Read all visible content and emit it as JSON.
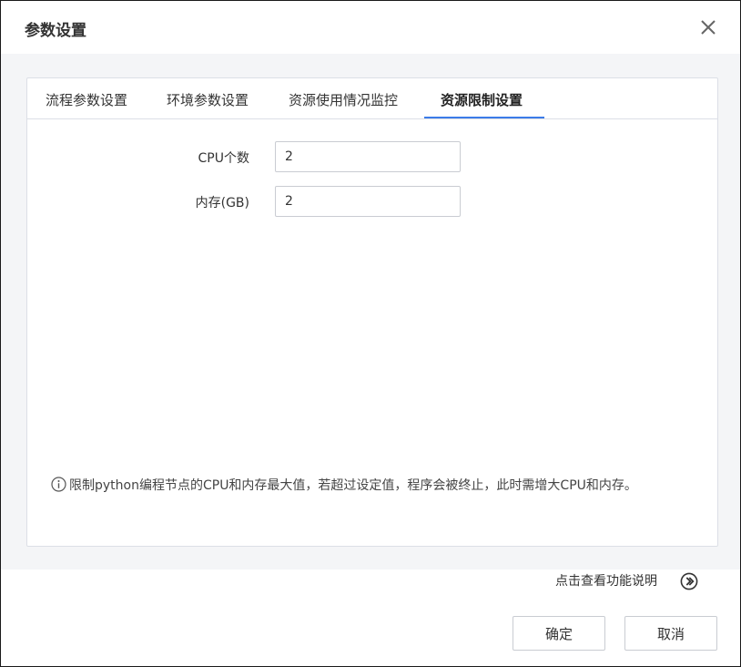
{
  "dialog": {
    "title": "参数设置"
  },
  "tabs": [
    {
      "label": "流程参数设置",
      "active": false
    },
    {
      "label": "环境参数设置",
      "active": false
    },
    {
      "label": "资源使用情况监控",
      "active": false
    },
    {
      "label": "资源限制设置",
      "active": true
    }
  ],
  "form": {
    "cpu_label": "CPU个数",
    "cpu_value": "2",
    "memory_label": "内存(GB)",
    "memory_value": "2"
  },
  "hint": {
    "text": "限制python编程节点的CPU和内存最大值，若超过设定值，程序会被终止，此时需增大CPU和内存。"
  },
  "help": {
    "label": "点击查看功能说明"
  },
  "buttons": {
    "confirm_label": "确定",
    "cancel_label": "取消"
  },
  "colors": {
    "accent": "#3c7be8",
    "body_bg": "#f4f5f7",
    "border": "#dcdfe6"
  }
}
